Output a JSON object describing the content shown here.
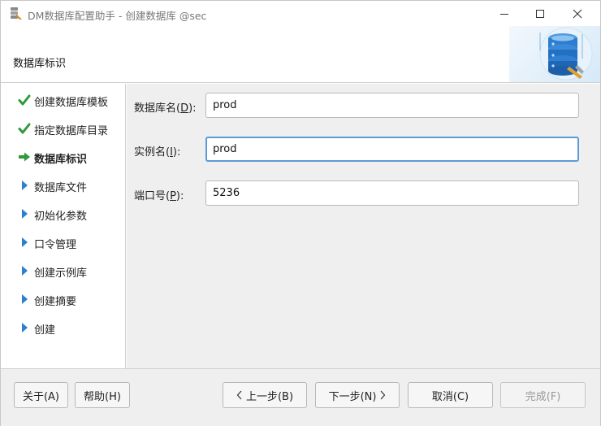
{
  "window": {
    "title": "DM数据库配置助手 - 创建数据库 @sec"
  },
  "header": {
    "title": "数据库标识",
    "art_icon": "database-server-icon"
  },
  "steps": [
    {
      "label": "创建数据库模板",
      "state": "done",
      "icon": "check-icon"
    },
    {
      "label": "指定数据库目录",
      "state": "done",
      "icon": "check-icon"
    },
    {
      "label": "数据库标识",
      "state": "current",
      "icon": "arrow-right-icon"
    },
    {
      "label": "数据库文件",
      "state": "pending",
      "icon": "triangle-right-icon"
    },
    {
      "label": "初始化参数",
      "state": "pending",
      "icon": "triangle-right-icon"
    },
    {
      "label": "口令管理",
      "state": "pending",
      "icon": "triangle-right-icon"
    },
    {
      "label": "创建示例库",
      "state": "pending",
      "icon": "triangle-right-icon"
    },
    {
      "label": "创建摘要",
      "state": "pending",
      "icon": "triangle-right-icon"
    },
    {
      "label": "创建",
      "state": "pending",
      "icon": "triangle-right-icon"
    }
  ],
  "form": {
    "db_name": {
      "label_pre": "数据库名(",
      "mnemonic": "D",
      "label_post": "):",
      "value": "prod"
    },
    "instance_name": {
      "label_pre": "实例名(",
      "mnemonic": "I",
      "label_post": "):",
      "value": "prod"
    },
    "port": {
      "label_pre": "端口号(",
      "mnemonic": "P",
      "label_post": "):",
      "value": "5236"
    }
  },
  "footer": {
    "about": "关于(A)",
    "help": "帮助(H)",
    "prev": "上一步(B)",
    "next": "下一步(N)",
    "cancel": "取消(C)",
    "finish": "完成(F)"
  },
  "colors": {
    "check": "#2f9a3a",
    "arrow": "#2f9a3a",
    "triangle": "#2d7fd0",
    "focus_border": "#5b9bd5"
  }
}
